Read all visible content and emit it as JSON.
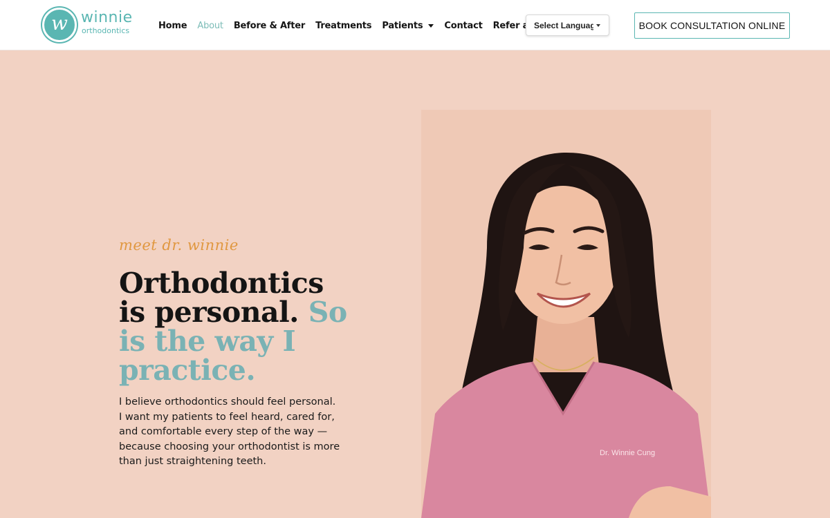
{
  "header": {
    "logo": {
      "icon": "w-monogram-icon",
      "word": "winnie",
      "sub": "orthodontics"
    },
    "nav": [
      {
        "label": "Home",
        "active": false
      },
      {
        "label": "About",
        "active": true
      },
      {
        "label": "Before & After",
        "active": false
      },
      {
        "label": "Treatments",
        "active": false
      },
      {
        "label": "Patients",
        "active": false,
        "has_dropdown": true
      },
      {
        "label": "Contact",
        "active": false
      },
      {
        "label": "Refer a Patient",
        "active": false
      }
    ],
    "language_select": {
      "value": "Select Language"
    },
    "cta_label": "BOOK CONSULTATION ONLINE"
  },
  "hero": {
    "eyebrow": "meet dr. winnie",
    "headline_dark": "Orthodontics is personal.",
    "headline_accent": "So is the way I practice.",
    "body": "I believe orthodontics should feel personal.  I want my patients to feel heard, cared for, and comfortable every step of the way — because choosing your orthodontist is more than just straightening teeth.",
    "portrait": {
      "scrub_embroidery": "Dr. Winnie Cung"
    }
  },
  "colors": {
    "teal": "#5ab6b2",
    "accent_text": "#7ab2b4",
    "eyebrow": "#e0973f",
    "background": "#f2d2c3",
    "scrubs": "#d9879f"
  }
}
